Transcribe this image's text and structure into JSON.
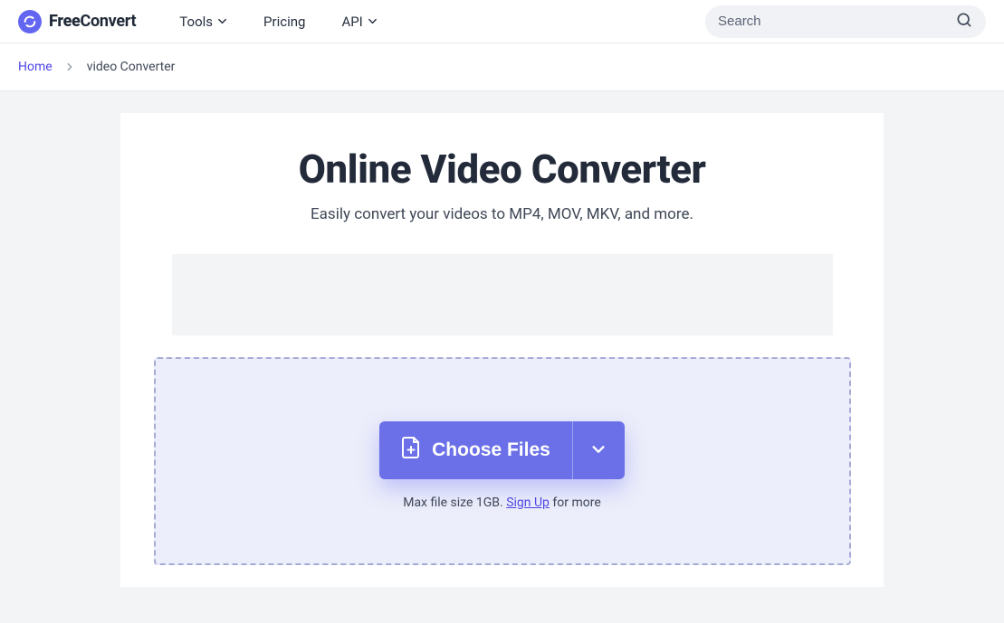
{
  "brand": {
    "free": "Free",
    "convert": "Convert"
  },
  "nav": {
    "tools": "Tools",
    "pricing": "Pricing",
    "api": "API"
  },
  "search": {
    "placeholder": "Search"
  },
  "breadcrumb": {
    "home": "Home",
    "current": "video Converter"
  },
  "main": {
    "title": "Online Video Converter",
    "subtitle": "Easily convert your videos to MP4, MOV, MKV, and more."
  },
  "upload": {
    "choose_label": "Choose Files",
    "hint_prefix": "Max file size 1GB. ",
    "signup": "Sign Up",
    "hint_suffix": " for more"
  }
}
